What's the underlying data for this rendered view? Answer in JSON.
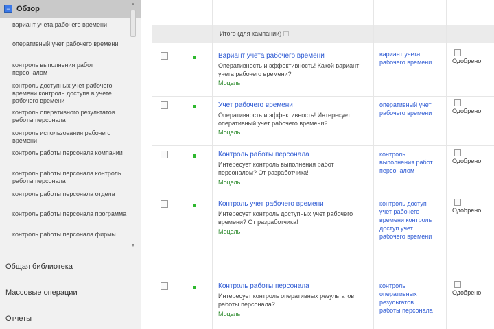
{
  "sidebar": {
    "header_title": "Обзор",
    "keywords": [
      "вариант учета рабочего времени",
      "оперативный учет рабочего времени",
      "контроль выполнения работ персоналом",
      "контроль доступных учет рабочего времени контроль доступа в учете рабочего времени",
      "контроль оперативного результатов работы персонала",
      "контроль использования рабочего времени",
      "контроль работы персонала компании",
      "контроль работы персонала контроль работы персонала",
      "контроль работы персонала отдела",
      "контроль работы персонала программа",
      "контроль работы персонала фирмы"
    ],
    "links": [
      "Общая библиотека",
      "Массовые операции",
      "Отчеты"
    ]
  },
  "table": {
    "header_label": "Итого (для кампании)",
    "rows": [
      {
        "title": "Вариант учета рабочего времени",
        "text": "Оперативность и эффективность! Какой вариант учета рабочего времени?",
        "url": "Моцель",
        "keywords": "вариант учета рабочего времени",
        "status": "Одобрено"
      },
      {
        "title": "Учет рабочего времени",
        "text": "Оперативность и эффективность! Интересует оперативный учет рабочего времени?",
        "url": "Моцель",
        "keywords": "оперативный учет рабочего времени",
        "status": "Одобрено"
      },
      {
        "title": "Контроль работы персонала",
        "text": "Интересует контроль выполнения работ персоналом? От разработчика!",
        "url": "Моцель",
        "keywords": "контроль выполнения работ персоналом",
        "status": "Одобрено"
      },
      {
        "title": "Контроль учет рабочего времени",
        "text": "Интересует контроль доступных учет рабочего времени? От разработчика!",
        "url": "Моцель",
        "keywords": "контроль доступ учет рабочего времени контроль доступ учет рабочего времени",
        "status": "Одобрено"
      },
      {
        "title": "Контроль работы персонала",
        "text": "Интересует контроль оперативных результатов работы персонала?",
        "url": "Моцель",
        "keywords": "контроль оперативных результатов работы персонала",
        "status": "Одобрено"
      }
    ]
  },
  "colors": {
    "link": "#2f5bd3",
    "url_green": "#2e8b2e",
    "status_green": "#2eb82e",
    "header_band": "#ebebeb"
  }
}
